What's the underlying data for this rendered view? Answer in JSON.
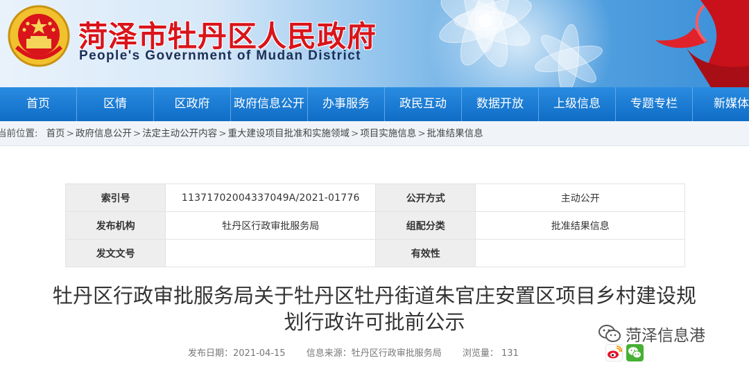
{
  "header": {
    "title_cn": "菏泽市牡丹区人民政府",
    "title_en": "People's Government of Mudan District"
  },
  "nav": {
    "items": [
      {
        "label": "首页"
      },
      {
        "label": "区情"
      },
      {
        "label": "区政府"
      },
      {
        "label": "政府信息公开"
      },
      {
        "label": "办事服务"
      },
      {
        "label": "政民互动"
      },
      {
        "label": "数据开放"
      },
      {
        "label": "上级信息"
      },
      {
        "label": "专题专栏"
      },
      {
        "label": "新媒体"
      }
    ]
  },
  "breadcrumb": {
    "label": "当前位置:",
    "items": [
      "首页",
      "政府信息公开",
      "法定主动公开内容",
      "重大建设项目批准和实施领域",
      "项目实施信息",
      "批准结果信息"
    ],
    "separator": ">"
  },
  "meta": {
    "index_label": "索引号",
    "index_value": "11371702004337049A/2021-01776",
    "disclosure_label": "公开方式",
    "disclosure_value": "主动公开",
    "publisher_label": "发布机构",
    "publisher_value": "牡丹区行政审批服务局",
    "category_label": "组配分类",
    "category_value": "批准结果信息",
    "docno_label": "发文文号",
    "docno_value": "",
    "validity_label": "有效性",
    "validity_value": ""
  },
  "article": {
    "title_line1": "牡丹区行政审批服务局关于牡丹区牡丹街道朱官庄安置区项目乡村建设规",
    "title_line2": "划行政许可批前公示",
    "publish_date": "发布日期：2021-04-15",
    "source": "信息来源：牡丹区行政审批服务局",
    "views": "浏览量：  131"
  },
  "watermark": {
    "text": "菏泽信息港"
  },
  "icons": {
    "emblem": "national-emblem-icon",
    "weibo": "weibo-icon",
    "wechat": "wechat-icon",
    "watermark": "wechat-channel-icon"
  },
  "colors": {
    "title_red": "#d9141b",
    "nav_blue": "#1378d2",
    "accent_blue": "#3b8fd8"
  }
}
